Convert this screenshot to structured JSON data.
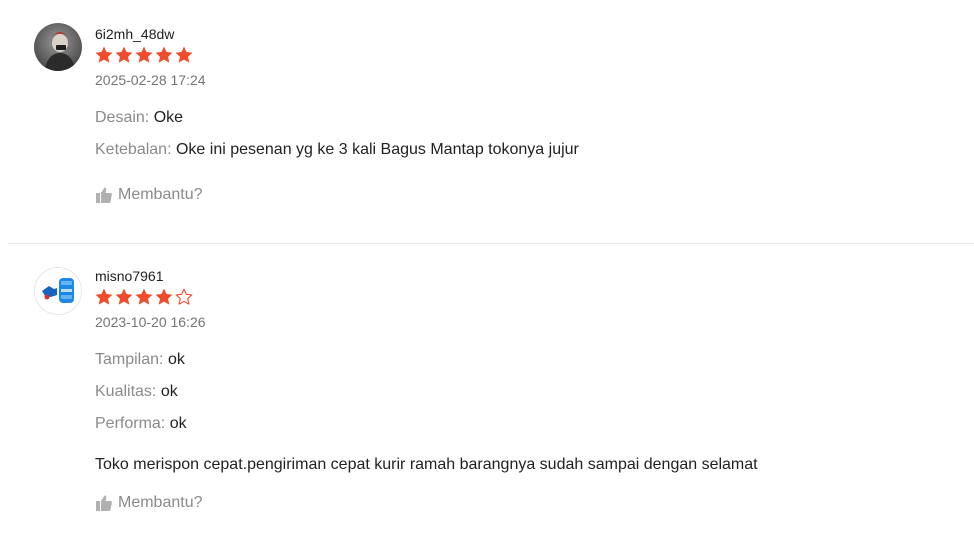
{
  "reviews": [
    {
      "username": "6i2mh_48dw",
      "rating": 5,
      "max_rating": 5,
      "timestamp": "2025-02-28 17:24",
      "attributes": [
        {
          "label": "Desain:",
          "value": "Oke"
        },
        {
          "label": "Ketebalan:",
          "value": "Oke ini pesenan yg ke 3 kali Bagus Mantap tokonya jujur"
        }
      ],
      "comment": "",
      "helpful_label": "Membantu?"
    },
    {
      "username": "misno7961",
      "rating": 4,
      "max_rating": 5,
      "timestamp": "2023-10-20 16:26",
      "attributes": [
        {
          "label": "Tampilan:",
          "value": "ok"
        },
        {
          "label": "Kualitas:",
          "value": "ok"
        },
        {
          "label": "Performa:",
          "value": "ok"
        }
      ],
      "comment": "Toko merispon cepat.pengiriman cepat kurir ramah barangnya sudah sampai dengan selamat",
      "helpful_label": "Membantu?"
    }
  ],
  "colors": {
    "star": "#ee4d2d",
    "label": "#8a8a8a",
    "text": "#222222",
    "divider": "#e8e8e8"
  },
  "icons": {
    "star_filled": "star-filled-icon",
    "star_empty": "star-outline-icon",
    "helpful": "thumbs-up-icon"
  }
}
